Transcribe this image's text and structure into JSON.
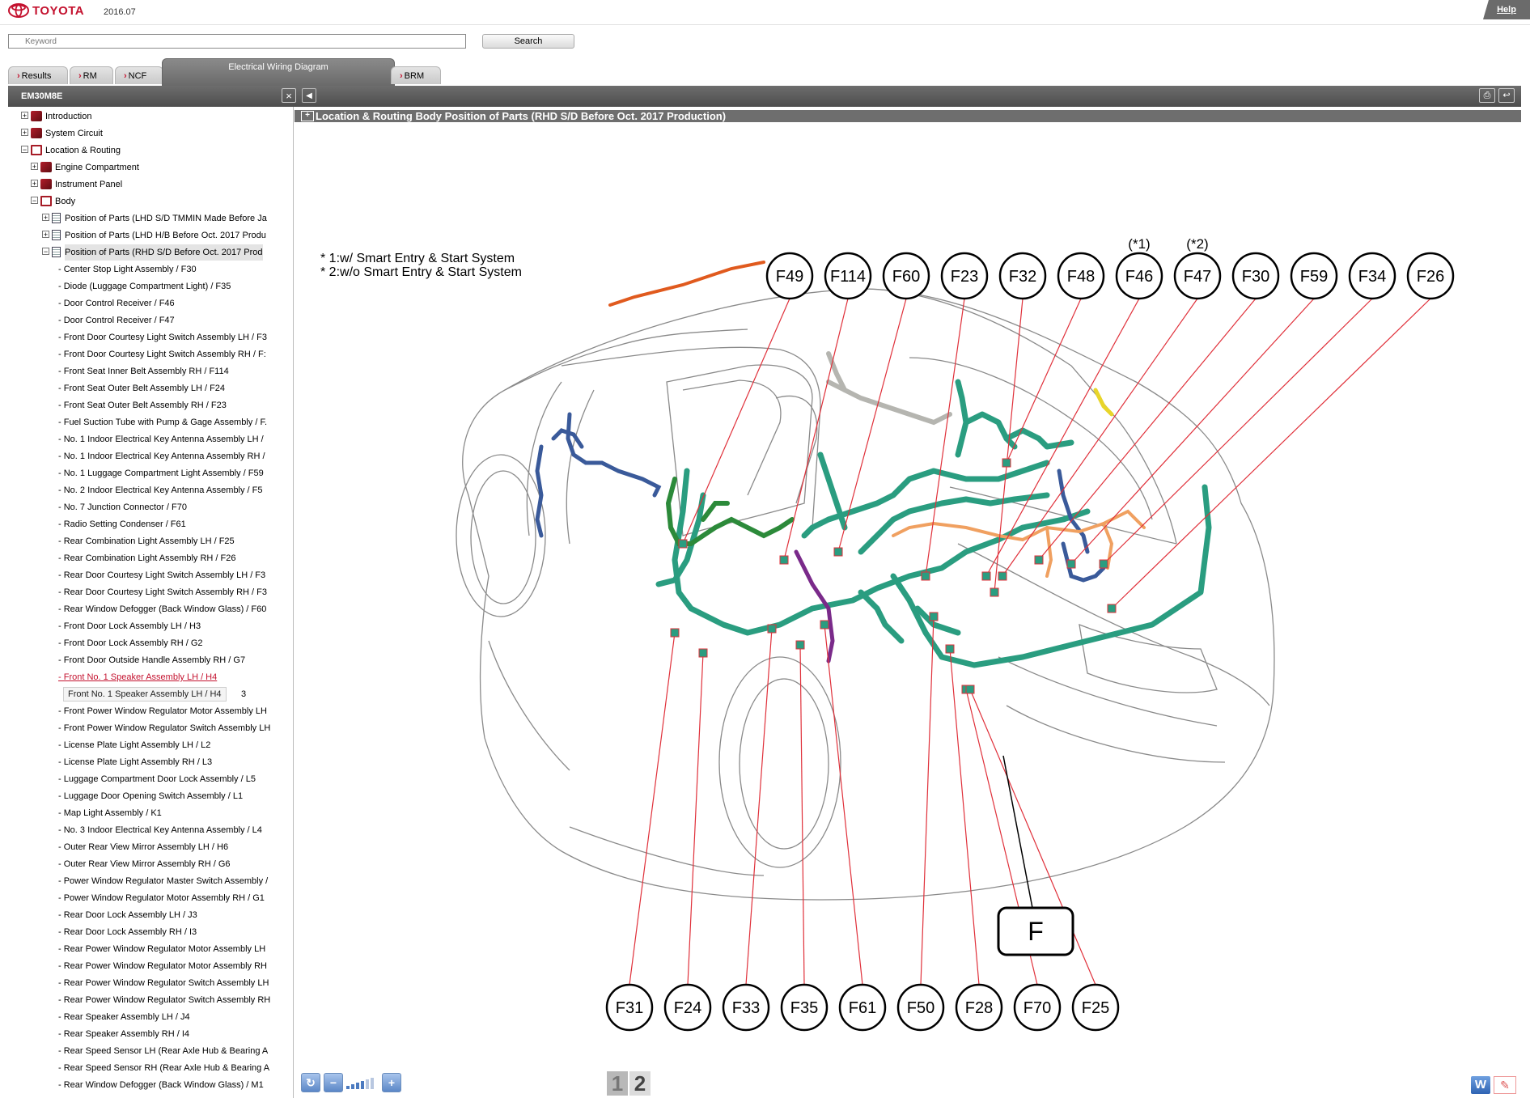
{
  "brand": {
    "name": "TOYOTA",
    "version": "2016.07",
    "help_label": "Help"
  },
  "search": {
    "placeholder": "Keyword",
    "button_label": "Search"
  },
  "tabs": [
    {
      "label": "Results"
    },
    {
      "label": "RM"
    },
    {
      "label": "NCF"
    },
    {
      "label": "Electrical Wiring Diagram",
      "active": true
    },
    {
      "label": "BRM"
    }
  ],
  "sidebar": {
    "doc_id": "EM30M8E",
    "close_label": "×",
    "tree": [
      {
        "label": "Introduction",
        "expander": "+",
        "icon": "book-icon"
      },
      {
        "label": "System Circuit",
        "expander": "+",
        "icon": "book-icon"
      },
      {
        "label": "Location & Routing",
        "expander": "−",
        "icon": "book-open-icon"
      },
      {
        "label": "Engine Compartment",
        "expander": "+",
        "icon": "book-icon"
      },
      {
        "label": "Instrument Panel",
        "expander": "+",
        "icon": "book-icon"
      },
      {
        "label": "Body",
        "expander": "−",
        "icon": "book-open-icon"
      },
      {
        "label": "Position of Parts (LHD S/D TMMIN Made Before Ja",
        "expander": "+",
        "icon": "document-icon"
      },
      {
        "label": "Position of Parts (LHD H/B Before Oct. 2017 Produ",
        "expander": "+",
        "icon": "document-icon"
      },
      {
        "label": "Position of Parts (RHD S/D Before Oct. 2017 Prod",
        "expander": "−",
        "icon": "document-icon",
        "selected": true
      }
    ],
    "parts": [
      "- Center Stop Light Assembly / F30",
      "- Diode (Luggage Compartment Light) / F35",
      "- Door Control Receiver / F46",
      "- Door Control Receiver / F47",
      "- Front Door Courtesy Light Switch Assembly LH / F3",
      "- Front Door Courtesy Light Switch Assembly RH / F:",
      "- Front Seat Inner Belt Assembly RH / F114",
      "- Front Seat Outer Belt Assembly LH / F24",
      "- Front Seat Outer Belt Assembly RH / F23",
      "- Fuel Suction Tube with Pump & Gage Assembly / F.",
      "- No. 1 Indoor Electrical Key Antenna Assembly LH /",
      "- No. 1 Indoor Electrical Key Antenna Assembly RH /",
      "- No. 1 Luggage Compartment Light Assembly / F59",
      "- No. 2 Indoor Electrical Key Antenna Assembly / F5",
      "- No. 7 Junction Connector / F70",
      "- Radio Setting Condenser / F61",
      "- Rear Combination Light Assembly LH / F25",
      "- Rear Combination Light Assembly RH / F26",
      "- Rear Door Courtesy Light Switch Assembly LH / F3",
      "- Rear Door Courtesy Light Switch Assembly RH / F3",
      "- Rear Window Defogger (Back Window Glass) / F60",
      "- Front Door Lock Assembly LH / H3",
      "- Front Door Lock Assembly RH / G2",
      "- Front Door Outside Handle Assembly RH / G7",
      "- Front No. 1 Speaker Assembly LH / H4",
      "3",
      "- Front Power Window Regulator Motor Assembly LH",
      "- Front Power Window Regulator Switch Assembly LH",
      "- License Plate Light Assembly LH / L2",
      "- License Plate Light Assembly RH / L3",
      "- Luggage Compartment Door Lock Assembly / L5",
      "- Luggage Door Opening Switch Assembly / L1",
      "- Map Light Assembly / K1",
      "- No. 3 Indoor Electrical Key Antenna Assembly / L4",
      "- Outer Rear View Mirror Assembly LH / H6",
      "- Outer Rear View Mirror Assembly RH / G6",
      "- Power Window Regulator Master Switch Assembly /",
      "- Power Window Regulator Motor Assembly RH / G1",
      "- Rear Door Lock Assembly LH / J3",
      "- Rear Door Lock Assembly RH / I3",
      "- Rear Power Window Regulator Motor Assembly LH",
      "- Rear Power Window Regulator Motor Assembly RH",
      "- Rear Power Window Regulator Switch Assembly LH",
      "- Rear Power Window Regulator Switch Assembly RH",
      "- Rear Speaker Assembly LH / J4",
      "- Rear Speaker Assembly RH / I4",
      "- Rear Speed Sensor LH (Rear Axle Hub & Bearing A",
      "- Rear Speed Sensor RH (Rear Axle Hub & Bearing A",
      "- Rear Window Defogger (Back Window Glass) / M1"
    ],
    "hover_link_index": 24,
    "tooltip": "Front No. 1 Speaker Assembly LH / H4"
  },
  "content": {
    "title_expander": "+",
    "title": "Location & Routing  Body  Position of Parts (RHD S/D Before Oct. 2017 Production)",
    "diagram": {
      "notes": [
        "* 1:w/ Smart Entry & Start System",
        "* 2:w/o Smart Entry & Start System"
      ],
      "top_connectors": [
        "F49",
        "F114",
        "F60",
        "F23",
        "F32",
        "F48",
        "F46",
        "F47",
        "F30",
        "F59",
        "F34",
        "F26"
      ],
      "top_annotations": {
        "F46": "(*1)",
        "F47": "(*2)"
      },
      "bottom_connectors": [
        "F31",
        "F24",
        "F33",
        "F35",
        "F61",
        "F50",
        "F28",
        "F70",
        "F25"
      ],
      "harness_label": "F"
    }
  },
  "pager": {
    "pages": [
      "1",
      "2"
    ],
    "current": "1"
  },
  "toolbar": {
    "word_label": "W"
  },
  "colors": {
    "brand_red": "#c4122f",
    "harness_green": "#2a9d80",
    "harness_orange": "#f0a060",
    "harness_blue": "#3a5a9a",
    "leader_red": "#e0303a"
  }
}
